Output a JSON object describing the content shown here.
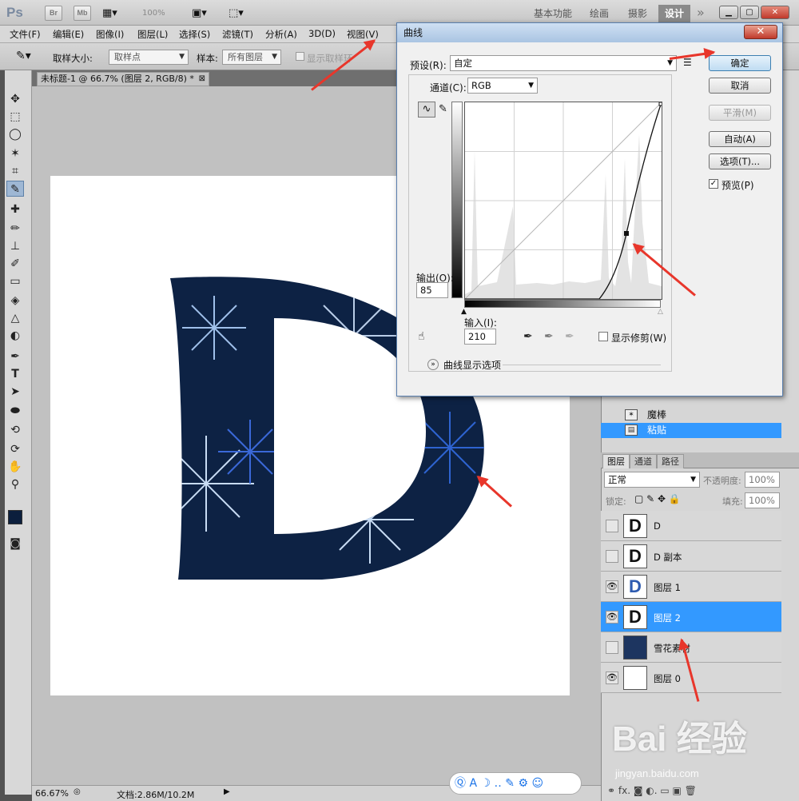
{
  "app": {
    "logo": "Ps",
    "bridge": "Br",
    "mini_bridge": "Mb",
    "zoom_select": "100%"
  },
  "workspaces": [
    "基本功能",
    "绘画",
    "摄影",
    "设计"
  ],
  "menu": [
    "文件(F)",
    "编辑(E)",
    "图像(I)",
    "图层(L)",
    "选择(S)",
    "滤镜(T)",
    "分析(A)",
    "3D(D)",
    "视图(V)"
  ],
  "options": {
    "sample_size_label": "取样大小:",
    "sample_size_value": "取样点",
    "sample_label": "样本:",
    "sample_value": "所有图层",
    "show_ring": "显示取样环"
  },
  "document": {
    "tab_title": "未标题-1 @ 66.7% (图层 2, RGB/8) *"
  },
  "status": {
    "zoom": "66.67%",
    "doc_size": "文档:2.86M/10.2M"
  },
  "curves": {
    "title": "曲线",
    "preset_label": "预设(R):",
    "preset_value": "自定",
    "channel_label": "通道(C):",
    "channel_value": "RGB",
    "output_label": "输出(O):",
    "output_value": "85",
    "input_label": "输入(I):",
    "input_value": "210",
    "show_clipping": "显示修剪(W)",
    "display_options": "曲线显示选项",
    "buttons": {
      "ok": "确定",
      "cancel": "取消",
      "smooth": "平滑(M)",
      "auto": "自动(A)",
      "options": "选项(T)...",
      "preview": "预览(P)"
    }
  },
  "history": [
    {
      "label": "魔棒"
    },
    {
      "label": "粘贴"
    }
  ],
  "panels": {
    "tabs": [
      "图层",
      "通道",
      "路径"
    ],
    "blend_mode": "正常",
    "opacity_label": "不透明度:",
    "opacity": "100%",
    "lock_label": "锁定:",
    "fill_label": "填充:",
    "fill": "100%"
  },
  "layers": [
    {
      "name": "D",
      "visible": false,
      "thumb": "D"
    },
    {
      "name": "D 副本",
      "visible": false,
      "thumb": "D"
    },
    {
      "name": "图层 1",
      "visible": true,
      "thumb": "D"
    },
    {
      "name": "图层 2",
      "visible": true,
      "thumb": "D",
      "selected": true
    },
    {
      "name": "雪花素材",
      "visible": false,
      "thumb": ""
    },
    {
      "name": "图层 0",
      "visible": true,
      "thumb": ""
    }
  ],
  "watermark": {
    "main": "Bai 经验",
    "sub": "jingyan.baidu.com"
  }
}
